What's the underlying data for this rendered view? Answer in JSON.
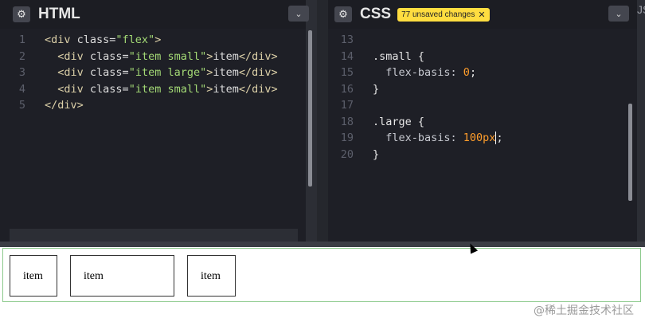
{
  "html_pane": {
    "title": "HTML",
    "settings_icon": "gear-icon",
    "collapse_icon": "chevron-down-icon",
    "lines": [
      {
        "num": "1",
        "parts": [
          {
            "c": "tag",
            "t": "<div "
          },
          {
            "c": "attr",
            "t": "class="
          },
          {
            "c": "str",
            "t": "\"flex\""
          },
          {
            "c": "tag",
            "t": ">"
          }
        ]
      },
      {
        "num": "2",
        "parts": [
          {
            "c": "tag",
            "t": "  <div "
          },
          {
            "c": "attr",
            "t": "class="
          },
          {
            "c": "str",
            "t": "\"item small\""
          },
          {
            "c": "tag",
            "t": ">"
          },
          {
            "c": "attr",
            "t": "item"
          },
          {
            "c": "tag",
            "t": "</div>"
          }
        ]
      },
      {
        "num": "3",
        "parts": [
          {
            "c": "tag",
            "t": "  <div "
          },
          {
            "c": "attr",
            "t": "class="
          },
          {
            "c": "str",
            "t": "\"item large\""
          },
          {
            "c": "tag",
            "t": ">"
          },
          {
            "c": "attr",
            "t": "item"
          },
          {
            "c": "tag",
            "t": "</div>"
          }
        ]
      },
      {
        "num": "4",
        "parts": [
          {
            "c": "tag",
            "t": "  <div "
          },
          {
            "c": "attr",
            "t": "class="
          },
          {
            "c": "str",
            "t": "\"item small\""
          },
          {
            "c": "tag",
            "t": ">"
          },
          {
            "c": "attr",
            "t": "item"
          },
          {
            "c": "tag",
            "t": "</div>"
          }
        ]
      },
      {
        "num": "5",
        "parts": [
          {
            "c": "tag",
            "t": "</div>"
          }
        ]
      }
    ]
  },
  "css_pane": {
    "title": "CSS",
    "unsaved_badge": "77 unsaved changes",
    "settings_icon": "gear-icon",
    "collapse_icon": "chevron-down-icon",
    "lines": [
      {
        "num": "13",
        "parts": []
      },
      {
        "num": "14",
        "parts": [
          {
            "c": "sel",
            "t": ".small {"
          }
        ]
      },
      {
        "num": "15",
        "parts": [
          {
            "c": "prop",
            "t": "  flex-basis: "
          },
          {
            "c": "num",
            "t": "0"
          },
          {
            "c": "sel",
            "t": ";"
          }
        ]
      },
      {
        "num": "16",
        "parts": [
          {
            "c": "sel",
            "t": "}"
          }
        ]
      },
      {
        "num": "17",
        "parts": []
      },
      {
        "num": "18",
        "parts": [
          {
            "c": "sel",
            "t": ".large {"
          }
        ]
      },
      {
        "num": "19",
        "parts": [
          {
            "c": "prop",
            "t": "  flex-basis: "
          },
          {
            "c": "num",
            "t": "100px"
          },
          {
            "c": "cursor",
            "t": ""
          },
          {
            "c": "sel",
            "t": ";"
          }
        ]
      },
      {
        "num": "20",
        "parts": [
          {
            "c": "sel",
            "t": "}"
          }
        ]
      }
    ]
  },
  "js_pane": {
    "label": "JS"
  },
  "result": {
    "items": [
      "item",
      "item",
      "item"
    ]
  },
  "watermark": "@稀土掘金技术社区"
}
